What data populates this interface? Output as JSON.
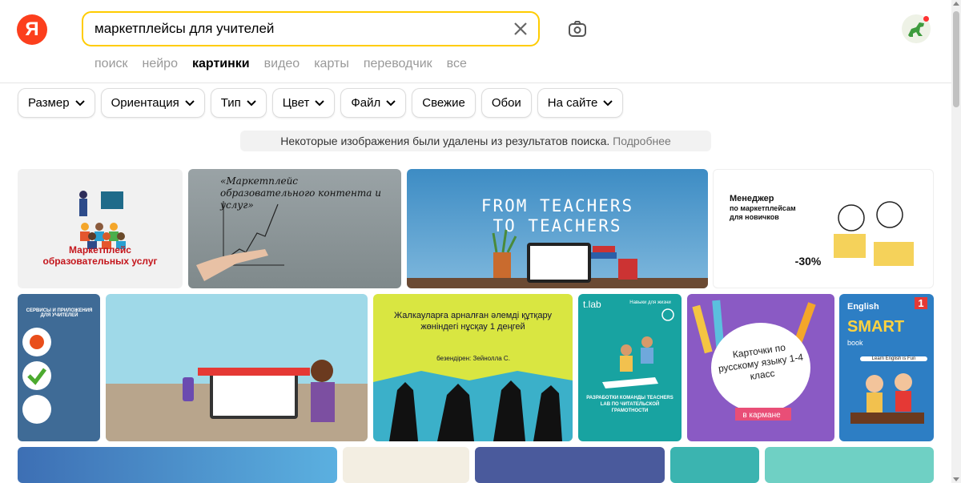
{
  "logo": {
    "letter": "Я",
    "color": "#fc3f1d"
  },
  "search": {
    "query": "маркетплейсы для учителей",
    "accent": "#ffcc00"
  },
  "tabs": [
    {
      "label": "поиск",
      "active": false
    },
    {
      "label": "нейро",
      "active": false
    },
    {
      "label": "картинки",
      "active": true
    },
    {
      "label": "видео",
      "active": false
    },
    {
      "label": "карты",
      "active": false
    },
    {
      "label": "переводчик",
      "active": false
    },
    {
      "label": "все",
      "active": false
    }
  ],
  "filters": [
    {
      "label": "Размер",
      "dropdown": true
    },
    {
      "label": "Ориентация",
      "dropdown": true
    },
    {
      "label": "Тип",
      "dropdown": true
    },
    {
      "label": "Цвет",
      "dropdown": true
    },
    {
      "label": "Файл",
      "dropdown": true
    },
    {
      "label": "Свежие",
      "dropdown": false
    },
    {
      "label": "Обои",
      "dropdown": false
    },
    {
      "label": "На сайте",
      "dropdown": true
    }
  ],
  "notice": {
    "text": "Некоторые изображения были удалены из результатов поиска.",
    "link": "Подробнее"
  },
  "images": {
    "img1": {
      "caption": "Маркетплейс образовательных услуг"
    },
    "img2": {
      "caption": "«Маркетплейс образовательного контента и услуг»"
    },
    "img3": {
      "caption": "FROM TEACHERS TO TEACHERS"
    },
    "img4": {
      "line1": "Менеджер",
      "line2": "по маркетплейсам для новичков",
      "discount": "-30%"
    },
    "img5": {
      "title": "СЕРВИСЫ И ПРИЛОЖЕНИЯ ДЛЯ УЧИТЕЛЕЙ"
    },
    "img7": {
      "title": "Жалкауларға арналған әлемді құтқару жөніндегі нұсқау 1 деңгей",
      "author": "безендірен: Зейнолла С."
    },
    "img8": {
      "brand": "t.lab",
      "tag": "Навыки для жизни",
      "caption": "РАЗРАБОТКИ КОМАНДЫ TEACHERS LAB ПО ЧИТАТЕЛЬСКОЙ ГРАМОТНОСТИ"
    },
    "img9": {
      "caption": "Карточки по русскому языку 1-4 класс",
      "badge": "в кармане"
    },
    "img10": {
      "top": "English",
      "title": "SMART",
      "sub": "book",
      "grade": "1",
      "slogan": "Learn English is Fun"
    }
  }
}
